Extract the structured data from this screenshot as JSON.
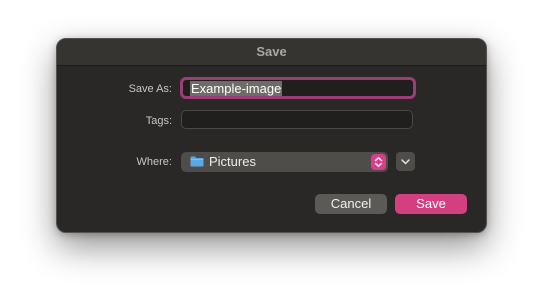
{
  "dialog": {
    "title": "Save",
    "save_as": {
      "label": "Save As:",
      "value": "Example-image"
    },
    "tags": {
      "label": "Tags:",
      "value": ""
    },
    "where": {
      "label": "Where:",
      "value": "Pictures",
      "icon": "folder-icon"
    },
    "buttons": {
      "cancel": "Cancel",
      "save": "Save"
    }
  },
  "colors": {
    "accent": "#d4407f",
    "focus_ring": "#9b3d76",
    "dialog_background": "#292826",
    "folder_icon": "#5aa9e6"
  }
}
